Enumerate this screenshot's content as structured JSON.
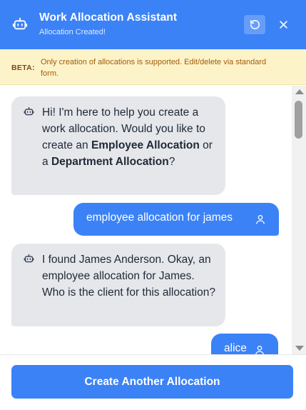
{
  "header": {
    "title": "Work Allocation Assistant",
    "subtitle": "Allocation Created!",
    "bot_icon": "robot-icon",
    "refresh_icon": "refresh-icon",
    "close_icon": "close-icon",
    "background_color": "#3b82f6"
  },
  "beta": {
    "label": "BETA:",
    "text": "Only creation of allocations is supported. Edit/delete via standard form."
  },
  "messages": [
    {
      "role": "bot",
      "parts": [
        {
          "text": "Hi! I'm here to help you create a work allocation. Would you like to create an ",
          "bold": false
        },
        {
          "text": "Employee Allocation",
          "bold": true
        },
        {
          "text": " or a ",
          "bold": false
        },
        {
          "text": "Department Allocation",
          "bold": true
        },
        {
          "text": "?",
          "bold": false
        }
      ]
    },
    {
      "role": "user",
      "text": "employee allocation for james",
      "icon": "user-icon"
    },
    {
      "role": "bot",
      "parts": [
        {
          "text": "I found James Anderson. Okay, an employee allocation for James. Who is the client for this allocation?",
          "bold": false
        }
      ]
    },
    {
      "role": "user",
      "text": "alice",
      "icon": "user-icon"
    }
  ],
  "footer": {
    "button_label": "Create Another Allocation"
  }
}
